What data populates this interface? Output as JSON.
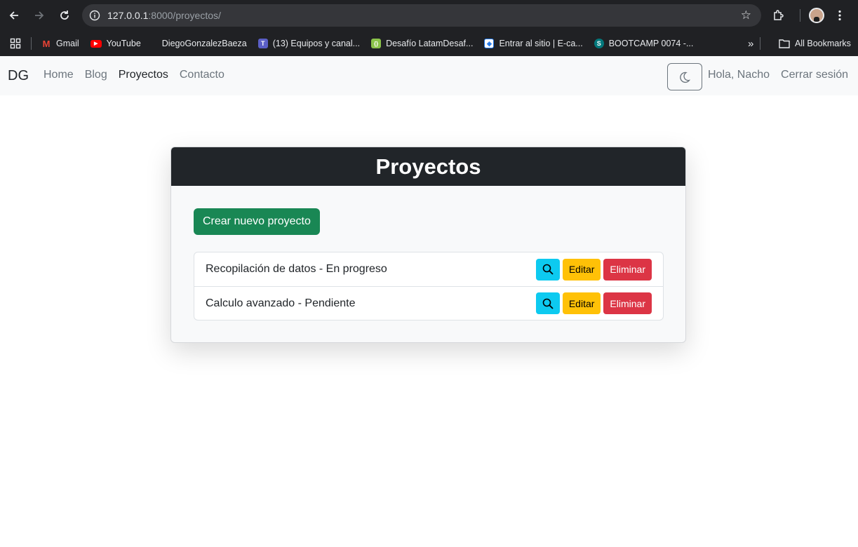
{
  "browser": {
    "url_host": "127.0.0.1",
    "url_rest": ":8000/proyectos/",
    "bookmarks": [
      {
        "label": "Gmail",
        "color": "#ea4335",
        "glyph": "M"
      },
      {
        "label": "YouTube",
        "color": "#ff0000",
        "glyph": "▶"
      },
      {
        "label": "DiegoGonzalezBaeza",
        "color": "#202124",
        "glyph": ""
      },
      {
        "label": "(13) Equipos y canal...",
        "color": "#5b5fc7",
        "glyph": "T"
      },
      {
        "label": "Desafío LatamDesaf...",
        "color": "#8bc34a",
        "glyph": "{}"
      },
      {
        "label": "Entrar al sitio | E-ca...",
        "color": "#1a73e8",
        "glyph": "◈"
      },
      {
        "label": "BOOTCAMP 0074 -...",
        "color": "#03787c",
        "glyph": "S"
      }
    ],
    "all_bookmarks": "All Bookmarks"
  },
  "navbar": {
    "brand": "DG",
    "links": [
      "Home",
      "Blog",
      "Proyectos",
      "Contacto"
    ],
    "greeting": "Hola, Nacho",
    "logout": "Cerrar sesión"
  },
  "card": {
    "title": "Proyectos",
    "create_label": "Crear nuevo proyecto",
    "items": [
      {
        "text": "Recopilación de datos - En progreso",
        "edit": "Editar",
        "delete": "Eliminar"
      },
      {
        "text": "Calculo avanzado - Pendiente",
        "edit": "Editar",
        "delete": "Eliminar"
      }
    ]
  },
  "colors": {
    "success": "#198754",
    "info": "#0dcaf0",
    "warning": "#ffc107",
    "danger": "#dc3545",
    "dark": "#212529"
  }
}
